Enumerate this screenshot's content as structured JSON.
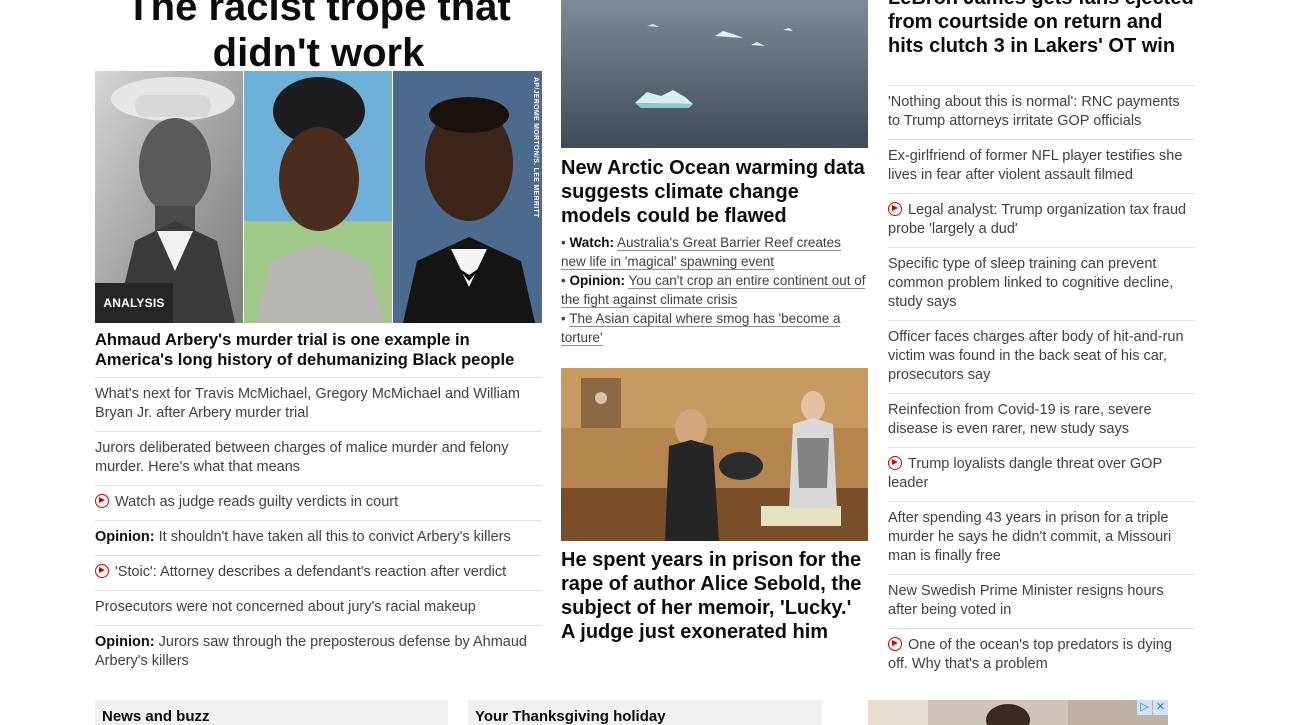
{
  "left": {
    "title": "The racist trope that didn't work",
    "badge": "ANALYSIS",
    "photo_credit": "AP/JEROME MORTON/S. LEE MERRITT",
    "headline": "Ahmaud Arbery's murder trial is one example in America's long history of dehumanizing Black people",
    "items": [
      {
        "text": "What's next for Travis McMichael, Gregory McMichael and William Bryan Jr. after Arbery murder trial"
      },
      {
        "text": "Jurors deliberated between charges of malice murder and felony murder. Here's what that means"
      },
      {
        "text": "Watch as judge reads guilty verdicts in court",
        "video": true
      },
      {
        "label": "Opinion:",
        "text": "It shouldn't have taken all this to convict Arbery's killers"
      },
      {
        "text": "'Stoic': Attorney describes a defendant's reaction after verdict",
        "video": true
      },
      {
        "text": "Prosecutors were not concerned about jury's racial makeup"
      },
      {
        "label": "Opinion:",
        "text": "Jurors saw through the preposterous defense by Ahmaud Arbery's killers"
      }
    ]
  },
  "middle": {
    "headline1": "New Arctic Ocean warming data suggests climate change models could be flawed",
    "bullets": [
      {
        "label": "Watch:",
        "text": "Australia's Great Barrier Reef creates new life in 'magical' spawning event"
      },
      {
        "label": "Opinion:",
        "text": "You can't crop an entire continent out of the fight against climate crisis"
      },
      {
        "label": "",
        "text": "The Asian capital where smog has 'become a torture'"
      }
    ],
    "headline2": "He spent years in prison for the rape of author Alice Sebold, the subject of her memoir, 'Lucky.' A judge just exonerated him"
  },
  "right": {
    "headline": "LeBron James gets fans ejected from courtside on return and hits clutch 3 in Lakers' OT win",
    "items": [
      {
        "text": "'Nothing about this is normal': RNC payments to Trump attorneys irritate GOP officials"
      },
      {
        "text": "Ex-girlfriend of former NFL player testifies she lives in fear after violent assault filmed"
      },
      {
        "text": "Legal analyst: Trump organization tax fraud probe 'largely a dud'",
        "video": true
      },
      {
        "text": "Specific type of sleep training can prevent common problem linked to cognitive decline, study says"
      },
      {
        "text": "Officer faces charges after body of hit-and-run victim was found in the back seat of his car, prosecutors say"
      },
      {
        "text": "Reinfection from Covid-19 is rare, severe disease is even rarer, new study says"
      },
      {
        "text": "Trump loyalists dangle threat over GOP leader",
        "video": true
      },
      {
        "text": "After spending 43 years in prison for a triple murder he says he didn't commit, a Missouri man is finally free"
      },
      {
        "text": "New Swedish Prime Minister resigns hours after being voted in"
      },
      {
        "text": "One of the ocean's top predators is dying off. Why that's a problem",
        "video": true
      }
    ]
  },
  "bottom": {
    "news_label": "News and buzz",
    "thanksgiving_label": "Your Thanksgiving holiday",
    "ad_icons": [
      "adchoices-icon",
      "close-icon"
    ]
  },
  "colors": {
    "video_red": "#cc0000",
    "rule": "#e1e1e1",
    "headline": "#0c0c0c",
    "text": "#404040"
  }
}
